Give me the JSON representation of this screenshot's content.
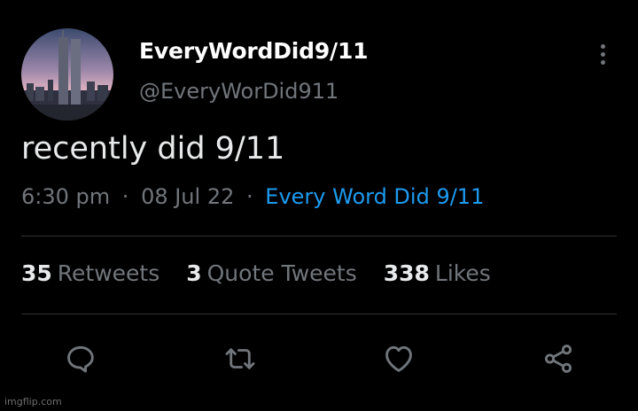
{
  "author": {
    "display_name": "EveryWordDid9/11",
    "handle": "@EveryWorDid911"
  },
  "tweet": {
    "text": "recently did 9/11",
    "time": "6:30 pm",
    "separator": "·",
    "date": "08 Jul 22",
    "source": "Every Word Did 9/11"
  },
  "stats": {
    "retweets": {
      "count": "35",
      "label": "Retweets"
    },
    "quotes": {
      "count": "3",
      "label": "Quote Tweets"
    },
    "likes": {
      "count": "338",
      "label": "Likes"
    }
  },
  "actions": [
    "reply-icon",
    "retweet-icon",
    "like-icon",
    "share-icon"
  ],
  "watermark": "imgflip.com",
  "colors": {
    "background": "#000000",
    "text": "#e7e9ea",
    "secondary": "#71767b",
    "link": "#1d9bf0",
    "divider": "#2f3336"
  }
}
